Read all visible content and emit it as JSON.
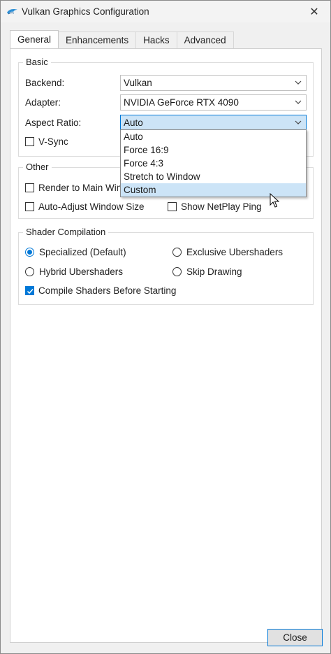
{
  "window": {
    "title": "Vulkan Graphics Configuration",
    "close_glyph": "✕"
  },
  "tabs": [
    {
      "label": "General",
      "active": true
    },
    {
      "label": "Enhancements",
      "active": false
    },
    {
      "label": "Hacks",
      "active": false
    },
    {
      "label": "Advanced",
      "active": false
    }
  ],
  "basic": {
    "title": "Basic",
    "backend_label": "Backend:",
    "backend_value": "Vulkan",
    "adapter_label": "Adapter:",
    "adapter_value": "NVIDIA GeForce RTX 4090",
    "aspect_label": "Aspect Ratio:",
    "aspect_value": "Auto",
    "vsync_label": "V-Sync",
    "vsync_checked": false
  },
  "aspect_options": [
    "Auto",
    "Force 16:9",
    "Force 4:3",
    "Stretch to Window",
    "Custom"
  ],
  "other": {
    "title": "Other",
    "render_main_label": "Render to Main Window",
    "auto_adjust_label": "Auto-Adjust Window Size",
    "netplay_label": "Show NetPlay Ping"
  },
  "shader": {
    "title": "Shader Compilation",
    "specialized_label": "Specialized (Default)",
    "exclusive_label": "Exclusive Ubershaders",
    "hybrid_label": "Hybrid Ubershaders",
    "skip_label": "Skip Drawing",
    "compile_before_label": "Compile Shaders Before Starting",
    "selected": "Specialized (Default)",
    "compile_before_checked": true
  },
  "footer": {
    "close_label": "Close"
  },
  "colors": {
    "accent": "#0078d7",
    "highlight": "#cce4f7",
    "background": "#f0f0f0"
  }
}
